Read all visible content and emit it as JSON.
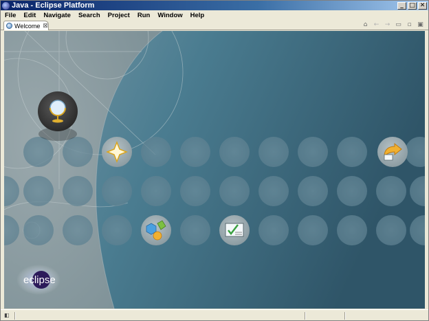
{
  "window": {
    "title": "Java - Eclipse Platform",
    "minimize": "_",
    "maximize": "□",
    "close": "✕"
  },
  "menu": [
    "File",
    "Edit",
    "Navigate",
    "Search",
    "Project",
    "Run",
    "Window",
    "Help"
  ],
  "tab": {
    "label": "Welcome",
    "close": "⊠"
  },
  "tab_tools": {
    "home": "⌂",
    "back": "←",
    "forward": "→",
    "restore": "▭",
    "minimize": "▫",
    "maximize": "▣"
  },
  "welcome": {
    "brand": "eclipse",
    "icons": {
      "overview": "globe-icon",
      "whats_new": "star-icon",
      "samples": "shapes-icon",
      "tutorials": "checklist-icon",
      "workbench": "arrow-icon"
    }
  },
  "colors": {
    "stage_dark": "#2f5668",
    "stage_light": "#6a8fa0",
    "panel": "#8a9ea6",
    "accent": "#e0a020"
  }
}
